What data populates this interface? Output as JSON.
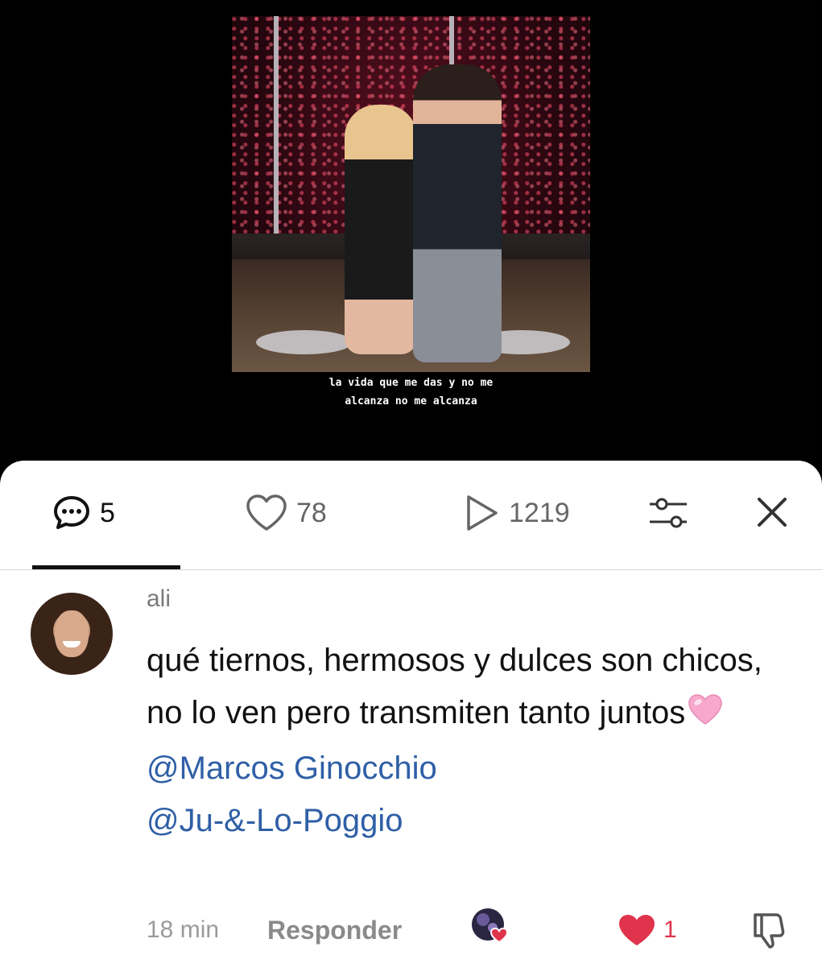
{
  "video": {
    "caption_line1": "la vida que me das y no me",
    "caption_line2": "alcanza no me alcanza"
  },
  "tabs": {
    "comments_count": "5",
    "likes_count": "78",
    "plays_count": "1219",
    "filter_icon": "sliders-icon",
    "close_icon": "close-icon"
  },
  "comment": {
    "author": "ali",
    "text": "qué tiernos, hermosos y dulces son chicos, no lo ven pero transmiten tanto juntos",
    "emoji": "pink-heart-emoji",
    "mention1": "@Marcos  Ginocchio",
    "mention2": "@Ju-&-Lo-Poggio",
    "time": "18 min",
    "reply_label": "Responder",
    "like_count": "1"
  },
  "colors": {
    "accent_like": "#e0344c",
    "mention": "#2f5fa6",
    "muted_text": "#7a7a7a"
  }
}
